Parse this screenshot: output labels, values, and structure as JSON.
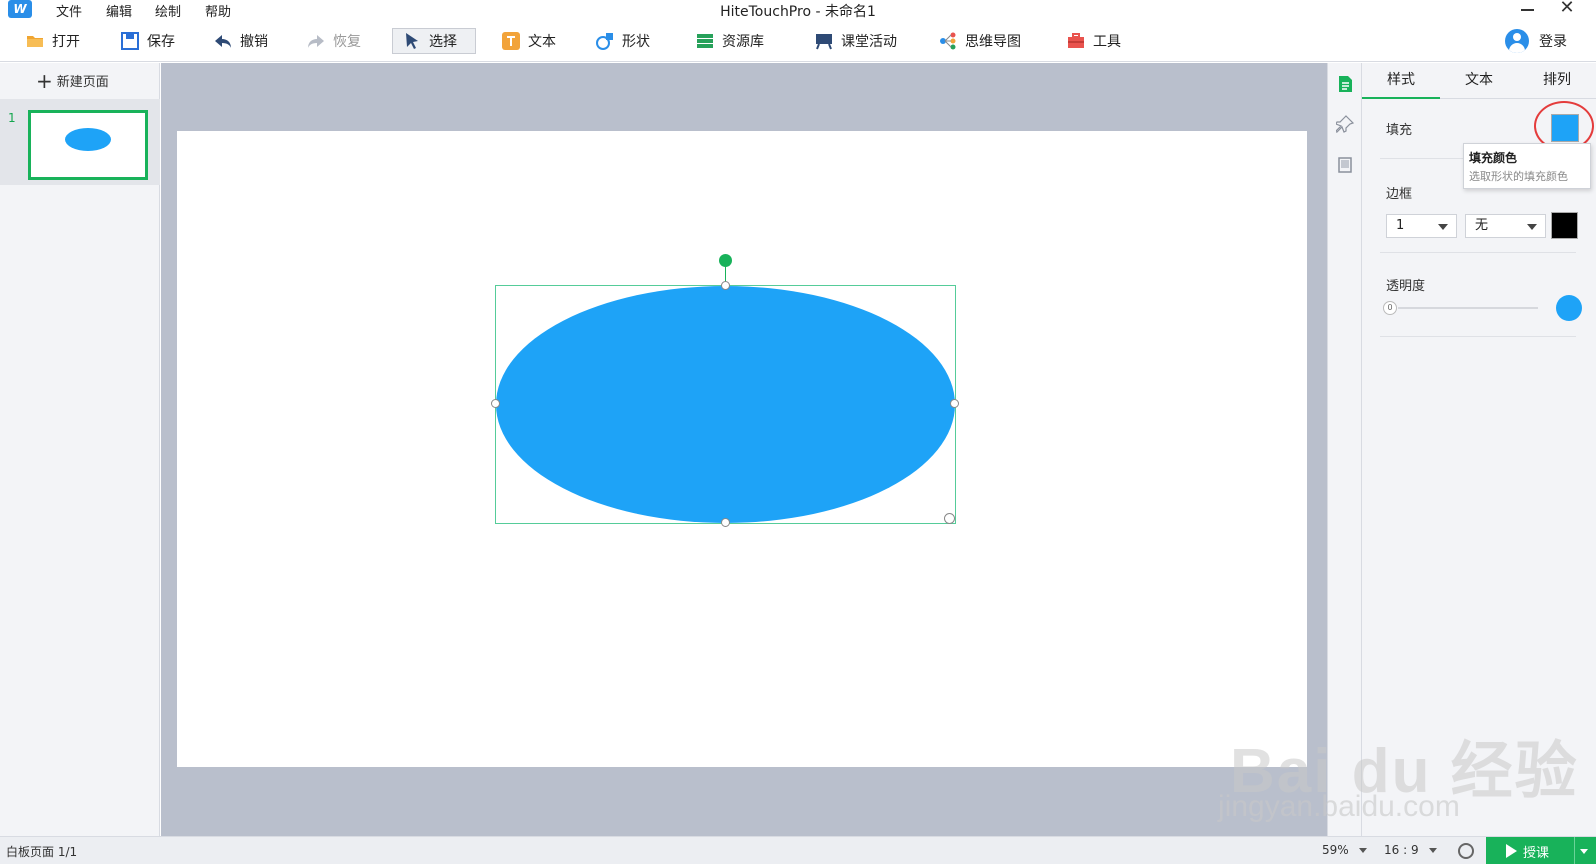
{
  "window": {
    "title": "HiteTouchPro - 未命名1",
    "menu": [
      "文件",
      "编辑",
      "绘制",
      "帮助"
    ]
  },
  "toolbar": {
    "open": "打开",
    "save": "保存",
    "undo": "撤销",
    "redo": "恢复",
    "select": "选择",
    "text": "文本",
    "shape": "形状",
    "resources": "资源库",
    "classroom_activity": "课堂活动",
    "mind_map": "思维导图",
    "tools": "工具",
    "login": "登录"
  },
  "pages_panel": {
    "new_page": "新建页面",
    "pages": [
      {
        "number": "1"
      }
    ]
  },
  "properties": {
    "tabs": [
      "样式",
      "文本",
      "排列"
    ],
    "active_tab": "样式",
    "fill_label": "填充",
    "fill_color": "#1ea3f7",
    "tooltip_title": "填充颜色",
    "tooltip_desc": "选取形状的填充颜色",
    "border_label": "边框",
    "border_width": "1",
    "border_style": "无",
    "border_color": "#000000",
    "opacity_label": "透明度",
    "opacity_value": "0"
  },
  "statusbar": {
    "page_info": "白板页面 1/1",
    "zoom": "59%",
    "aspect": "16 : 9",
    "teach": "授课"
  },
  "watermark": {
    "line1": "Bai du 经验",
    "line2": "jingyan.baidu.com"
  }
}
